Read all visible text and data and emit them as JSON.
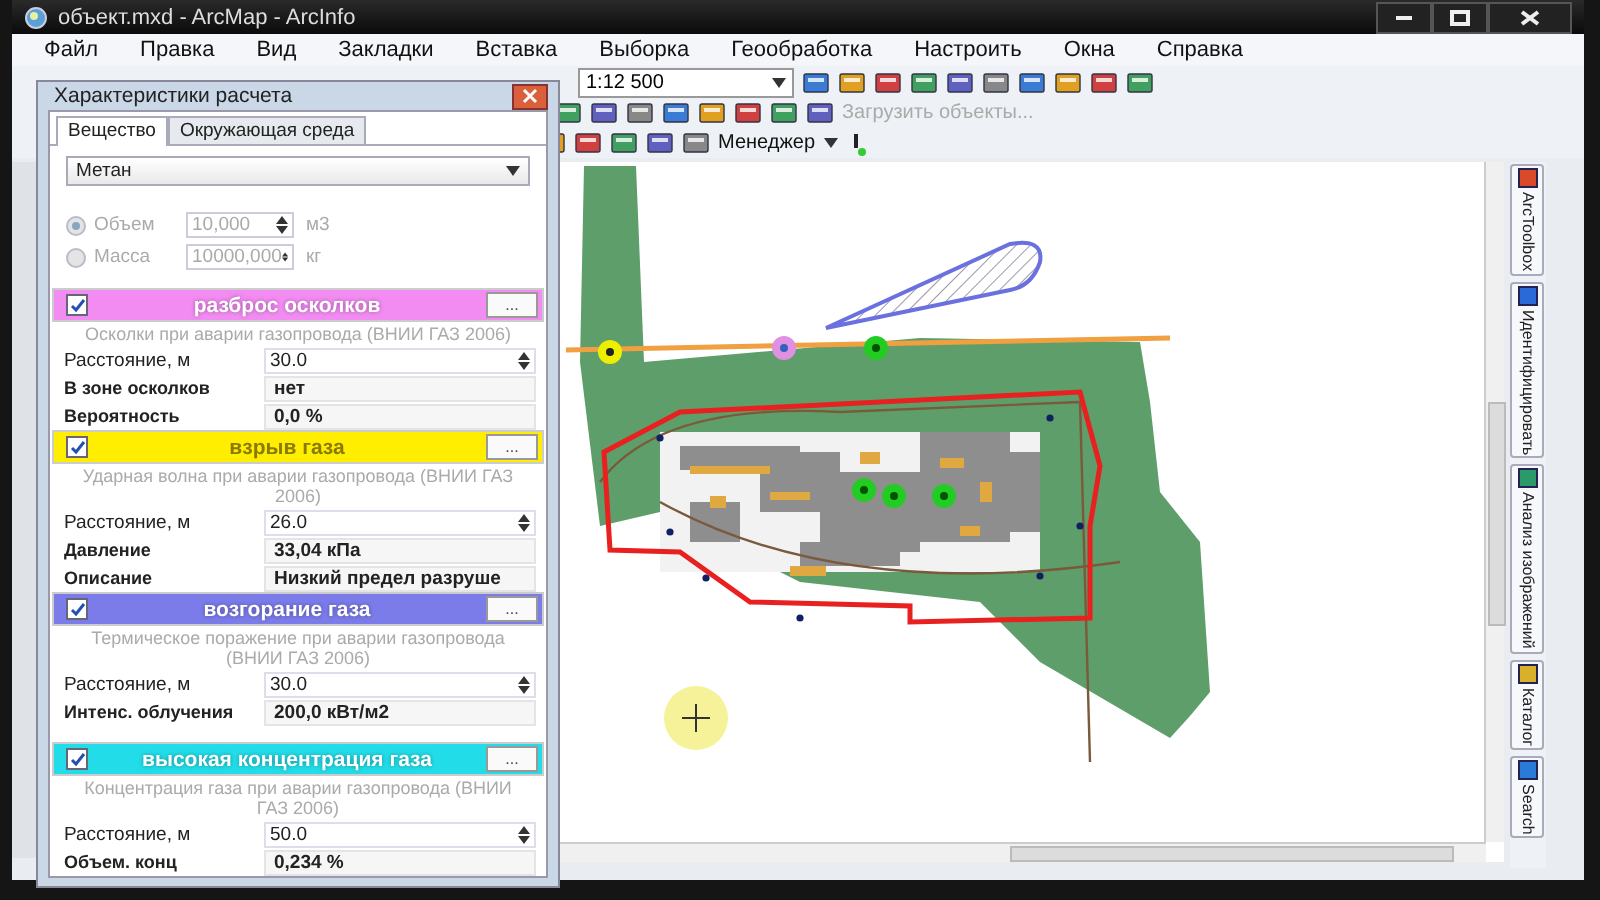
{
  "window": {
    "title": "объект.mxd - ArcMap - ArcInfo"
  },
  "menu": [
    "Файл",
    "Правка",
    "Вид",
    "Закладки",
    "Вставка",
    "Выборка",
    "Геообработка",
    "Настроить",
    "Окна",
    "Справка"
  ],
  "toolbars": {
    "scale": "1:12 500",
    "load_objects": {
      "label": "Загрузить объекты...",
      "disabled": true
    },
    "manager": "Менеджер"
  },
  "dialog": {
    "title": "Характеристики расчета",
    "tabs": [
      {
        "label": "Вещество",
        "selected": true
      },
      {
        "label": "Окружающая среда",
        "selected": false
      }
    ],
    "substance": "Метан",
    "amount_disabled": true,
    "amount": [
      {
        "label": "Объем",
        "value": "10,000",
        "unit": "м3",
        "selected": true
      },
      {
        "label": "Масса",
        "value": "10000,000",
        "unit": "кг",
        "selected": false
      }
    ],
    "sections": [
      {
        "title": "разброс осколков",
        "color": "#f28cf2",
        "checked": true,
        "button": "...",
        "description": "Осколки при аварии газопровода (ВНИИ ГАЗ 2006)",
        "distance": {
          "label": "Расстояние, м",
          "value": "30.0"
        },
        "results": [
          {
            "label": "В зоне осколков",
            "value": "нет"
          },
          {
            "label": "Вероятность",
            "value": "0,0 %"
          }
        ]
      },
      {
        "title": "взрыв газа",
        "color": "#ffee00",
        "checked": true,
        "button": "...",
        "description": "Ударная волна при аварии газопровода (ВНИИ ГАЗ 2006)",
        "distance": {
          "label": "Расстояние, м",
          "value": "26.0"
        },
        "results": [
          {
            "label": "Давление",
            "value": "33,04 кПа"
          },
          {
            "label": "Описание",
            "value": "**Низкий** предел разруше"
          }
        ]
      },
      {
        "title": "возгорание газа",
        "color": "#7b7bea",
        "checked": true,
        "button": "...",
        "description": "Термическое поражение при аварии газопровода (ВНИИ ГАЗ 2006)",
        "distance": {
          "label": "Расстояние, м",
          "value": "30.0"
        },
        "results": [
          {
            "label": "Интенс. облучения",
            "value": "200,0 кВт/м2"
          }
        ]
      },
      {
        "title": "высокая концентрация газа",
        "color": "#22dde8",
        "checked": true,
        "button": "...",
        "description": "Концентрация газа при аварии газопровода (ВНИИ ГАЗ 2006)",
        "distance": {
          "label": "Расстояние, м",
          "value": "50.0"
        },
        "results": [
          {
            "label": "Объем. конц",
            "value": "0,234 %"
          }
        ]
      }
    ]
  },
  "side_tabs": [
    "ArcToolbox",
    "Идентифицировать",
    "Анализ изображений",
    "Каталог",
    "Search"
  ]
}
